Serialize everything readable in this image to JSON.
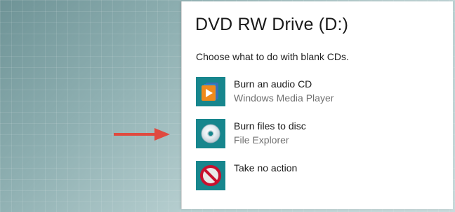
{
  "dialog": {
    "title": "DVD RW Drive (D:)",
    "subtitle": "Choose what to do with blank CDs."
  },
  "options": [
    {
      "name": "Burn an audio CD",
      "app": "Windows Media Player",
      "icon": "media-player-icon"
    },
    {
      "name": "Burn files to disc",
      "app": "File Explorer",
      "icon": "disc-icon"
    },
    {
      "name": "Take no action",
      "app": "",
      "icon": "no-action-icon"
    }
  ],
  "colors": {
    "tile": "#17868d",
    "arrow": "#e04a3f",
    "no_symbol": "#c8102e"
  }
}
